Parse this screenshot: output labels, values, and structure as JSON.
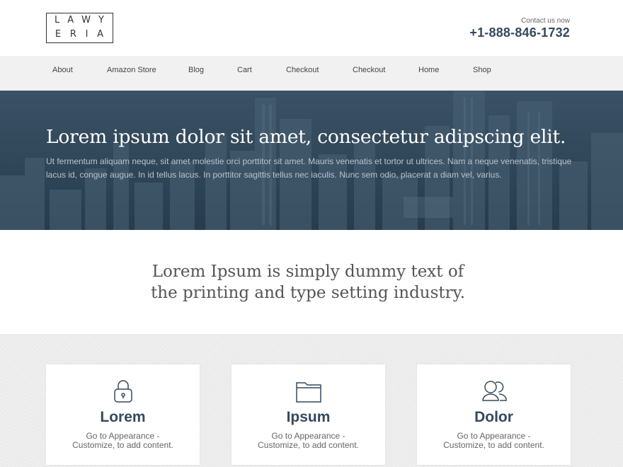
{
  "header": {
    "logo": {
      "row1": [
        "L",
        "A",
        "W",
        "Y"
      ],
      "row2": [
        "E",
        "R",
        "I",
        "A"
      ]
    },
    "contact_label": "Contact us now",
    "phone": "+1-888-846-1732"
  },
  "nav": {
    "items": [
      {
        "label": "About"
      },
      {
        "label": "Amazon Store"
      },
      {
        "label": "Blog"
      },
      {
        "label": "Cart"
      },
      {
        "label": "Checkout"
      },
      {
        "label": "Checkout"
      },
      {
        "label": "Home"
      },
      {
        "label": "Shop"
      }
    ]
  },
  "hero": {
    "title": "Lorem ipsum dolor sit amet, consectetur adipscing elit.",
    "text": "Ut fermentum aliquam neque, sit amet molestie orci porttitor sit amet. Mauris venenatis et tortor ut ultrices. Nam a neque venenatis, tristique lacus id, congue augue. In id tellus lacus. In porttitor sagittis tellus nec iaculis. Nunc sem odio, placerat a diam vel, varius."
  },
  "intro": {
    "line1": "Lorem Ipsum is simply dummy text of",
    "line2": "the printing and type setting industry."
  },
  "features": [
    {
      "icon": "lock-icon",
      "title": "Lorem",
      "line1": "Go to Appearance -",
      "line2": "Customize, to add content."
    },
    {
      "icon": "folder-icon",
      "title": "Ipsum",
      "line1": "Go to Appearance -",
      "line2": "Customize, to add content."
    },
    {
      "icon": "users-icon",
      "title": "Dolor",
      "line1": "Go to Appearance -",
      "line2": "Customize, to add content."
    }
  ],
  "colors": {
    "accent": "#34495e",
    "nav_bg": "#f1f1f1",
    "hero_overlay": "#2f4658"
  }
}
